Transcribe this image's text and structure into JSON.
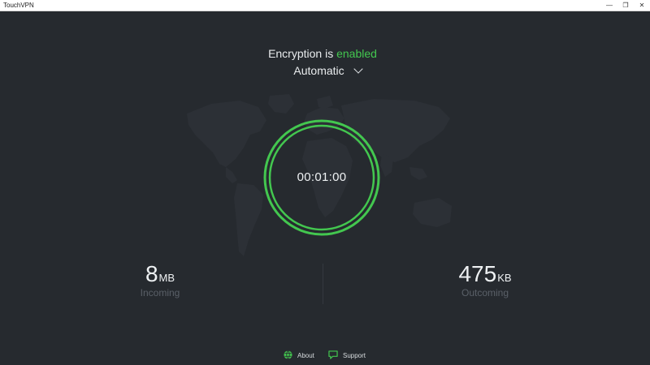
{
  "window": {
    "title": "TouchVPN",
    "controls": {
      "minimize": "—",
      "maximize": "❐",
      "close": "✕"
    }
  },
  "header": {
    "encryption_prefix": "Encryption is",
    "encryption_status": "enabled",
    "mode_selected": "Automatic"
  },
  "connection": {
    "timer": "00:01:00"
  },
  "stats": {
    "incoming": {
      "value": "8",
      "unit": "MB",
      "label": "Incoming"
    },
    "outgoing": {
      "value": "475",
      "unit": "KB",
      "label": "Outcoming"
    }
  },
  "footer": {
    "about_label": "About",
    "support_label": "Support"
  },
  "colors": {
    "background": "#262a2f",
    "accent_green": "#43c74f",
    "map_shape": "#2f3339",
    "muted_label": "#5a6068"
  },
  "icons": {
    "mode_dropdown": "chevron-down-icon",
    "about": "globe-icon",
    "support": "chat-bubble-icon"
  }
}
